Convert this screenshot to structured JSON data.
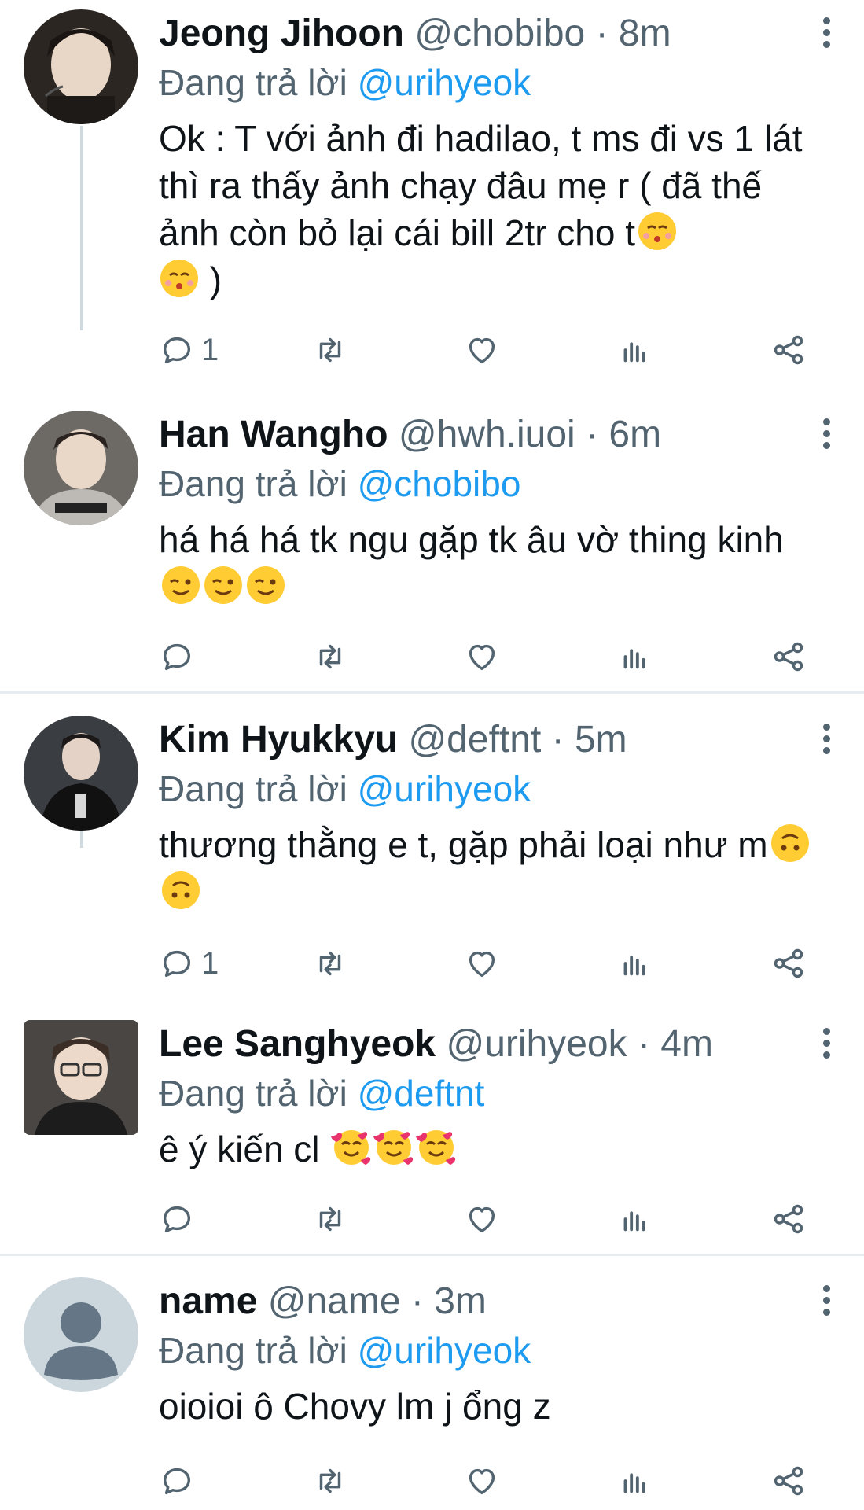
{
  "tweets": [
    {
      "name": "Jeong Jihoon",
      "handle": "@chobibo",
      "separator": "·",
      "time": "8m",
      "replying_prefix": "Đang trả lời",
      "replying_to": "@urihyeok",
      "text_1": "Ok : T với ảnh đi hadilao, t ms đi vs 1 lát thì ra thấy ảnh chạy đâu mẹ r ( đã thế ảnh còn bỏ lại cái bill 2tr cho t",
      "text_2": " )",
      "reply_count": "1",
      "emoji": "kissing-face-icon"
    },
    {
      "name": "Han Wangho",
      "handle": "@hwh.iuoi",
      "separator": "·",
      "time": "6m",
      "replying_prefix": "Đang trả lời",
      "replying_to": "@chobibo",
      "text_1": "há há há tk ngu gặp tk âu vờ thing kinh",
      "reply_count": "",
      "emoji": "winking-face-icon"
    },
    {
      "name": "Kim Hyukkyu",
      "handle": "@deftnt",
      "separator": "·",
      "time": "5m",
      "replying_prefix": "Đang trả lời",
      "replying_to": "@urihyeok",
      "text_1": "thương thằng e t, gặp phải loại như m",
      "reply_count": "1",
      "emoji": "upside-down-face-icon"
    },
    {
      "name": "Lee Sanghyeok",
      "handle": "@urihyeok",
      "separator": "·",
      "time": "4m",
      "replying_prefix": "Đang trả lời",
      "replying_to": "@deftnt",
      "text_1": "ê ý kiến cl ",
      "reply_count": "",
      "emoji": "smiling-face-with-hearts-icon"
    },
    {
      "name": "name",
      "handle": "@name",
      "separator": "·",
      "time": "3m",
      "replying_prefix": "Đang trả lời",
      "replying_to": "@urihyeok",
      "text_1": "oioioi ô Chovy lm j ổng z",
      "reply_count": "",
      "emoji": ""
    }
  ],
  "colors": {
    "accent": "#1d9bf0",
    "secondary_text": "#536471",
    "divider": "#e6ecf0",
    "emoji_yellow": "#ffcc33"
  }
}
